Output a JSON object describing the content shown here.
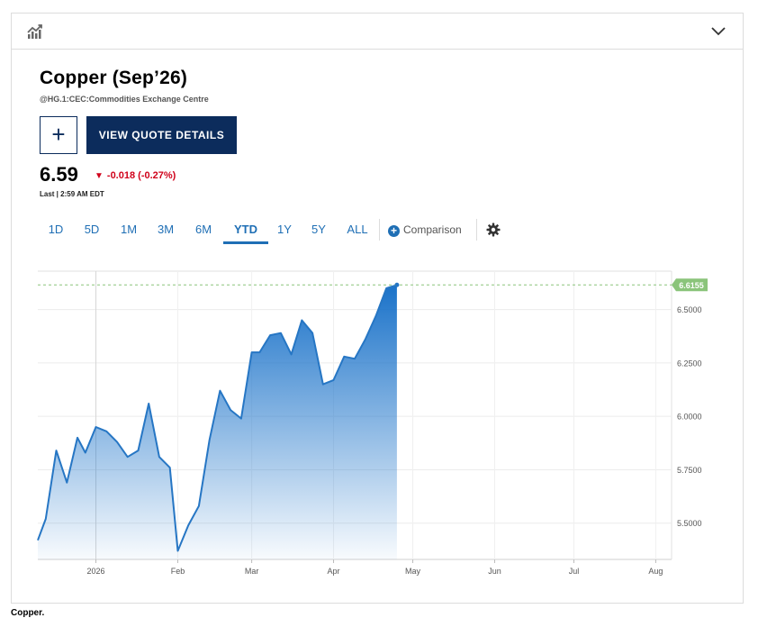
{
  "widget": {
    "title": "Copper (Sep’26)",
    "exchange": "@HG.1:CEC:Commodities Exchange Centre",
    "add_label": "+",
    "quote_button": "VIEW QUOTE DETAILS",
    "price": "6.59",
    "change": "-0.018 (-0.27%)",
    "last_updated": "Last | 2:59 AM EDT",
    "change_color": "#d0021b",
    "brand_color": "#0c2c5c",
    "accent_color": "#1f6fb5"
  },
  "tabs": [
    {
      "label": "1D",
      "active": false
    },
    {
      "label": "5D",
      "active": false
    },
    {
      "label": "1M",
      "active": false
    },
    {
      "label": "3M",
      "active": false
    },
    {
      "label": "6M",
      "active": false
    },
    {
      "label": "YTD",
      "active": true
    },
    {
      "label": "1Y",
      "active": false
    },
    {
      "label": "5Y",
      "active": false
    },
    {
      "label": "ALL",
      "active": false
    }
  ],
  "comparison_label": "Comparison",
  "icons": {
    "header": "chart-icon",
    "collapse": "chevron-down-icon",
    "settings": "gear-icon",
    "comparison": "plus-circle-icon"
  },
  "caption": "Copper.",
  "chart_data": {
    "type": "area",
    "x_labels": [
      "2026",
      "Feb",
      "Mar",
      "Apr",
      "May",
      "Jun",
      "Jul",
      "Aug"
    ],
    "x_label_days": [
      0,
      31,
      59,
      90,
      120,
      151,
      181,
      212
    ],
    "x_days": [
      -22,
      -19,
      -15,
      -11,
      -7,
      -4,
      0,
      4,
      8,
      12,
      16,
      20,
      24,
      28,
      31,
      35,
      39,
      43,
      47,
      51,
      55,
      59,
      62,
      66,
      70,
      74,
      78,
      82,
      86,
      90,
      94,
      98,
      102,
      106,
      110,
      114,
      118,
      122,
      126,
      130,
      133,
      137,
      141,
      145,
      149,
      153,
      157,
      161,
      165,
      169,
      173,
      177,
      181,
      185,
      189,
      193,
      197,
      201,
      205,
      209,
      213,
      217
    ],
    "values": [
      5.42,
      5.52,
      5.84,
      5.69,
      5.9,
      5.83,
      5.95,
      5.93,
      5.88,
      5.81,
      5.84,
      6.06,
      5.81,
      5.76,
      5.37,
      5.49,
      5.58,
      5.89,
      6.12,
      6.03,
      5.99,
      6.3,
      6.3,
      6.38,
      6.39,
      6.29,
      6.45,
      6.39,
      6.15,
      6.17,
      6.28,
      6.27,
      6.36,
      6.47,
      6.6,
      6.6155
    ],
    "last_value": "6.6155",
    "y_ticks": [
      "5.5000",
      "5.7500",
      "6.0000",
      "6.2500",
      "6.5000"
    ],
    "y_tick_values": [
      5.5,
      5.75,
      6.0,
      6.25,
      6.5
    ],
    "ylim": [
      5.33,
      6.68
    ],
    "xlim_days": [
      -22,
      218
    ],
    "line_color": "#2676c4",
    "last_badge_color": "#8ac47a",
    "grid": true
  }
}
